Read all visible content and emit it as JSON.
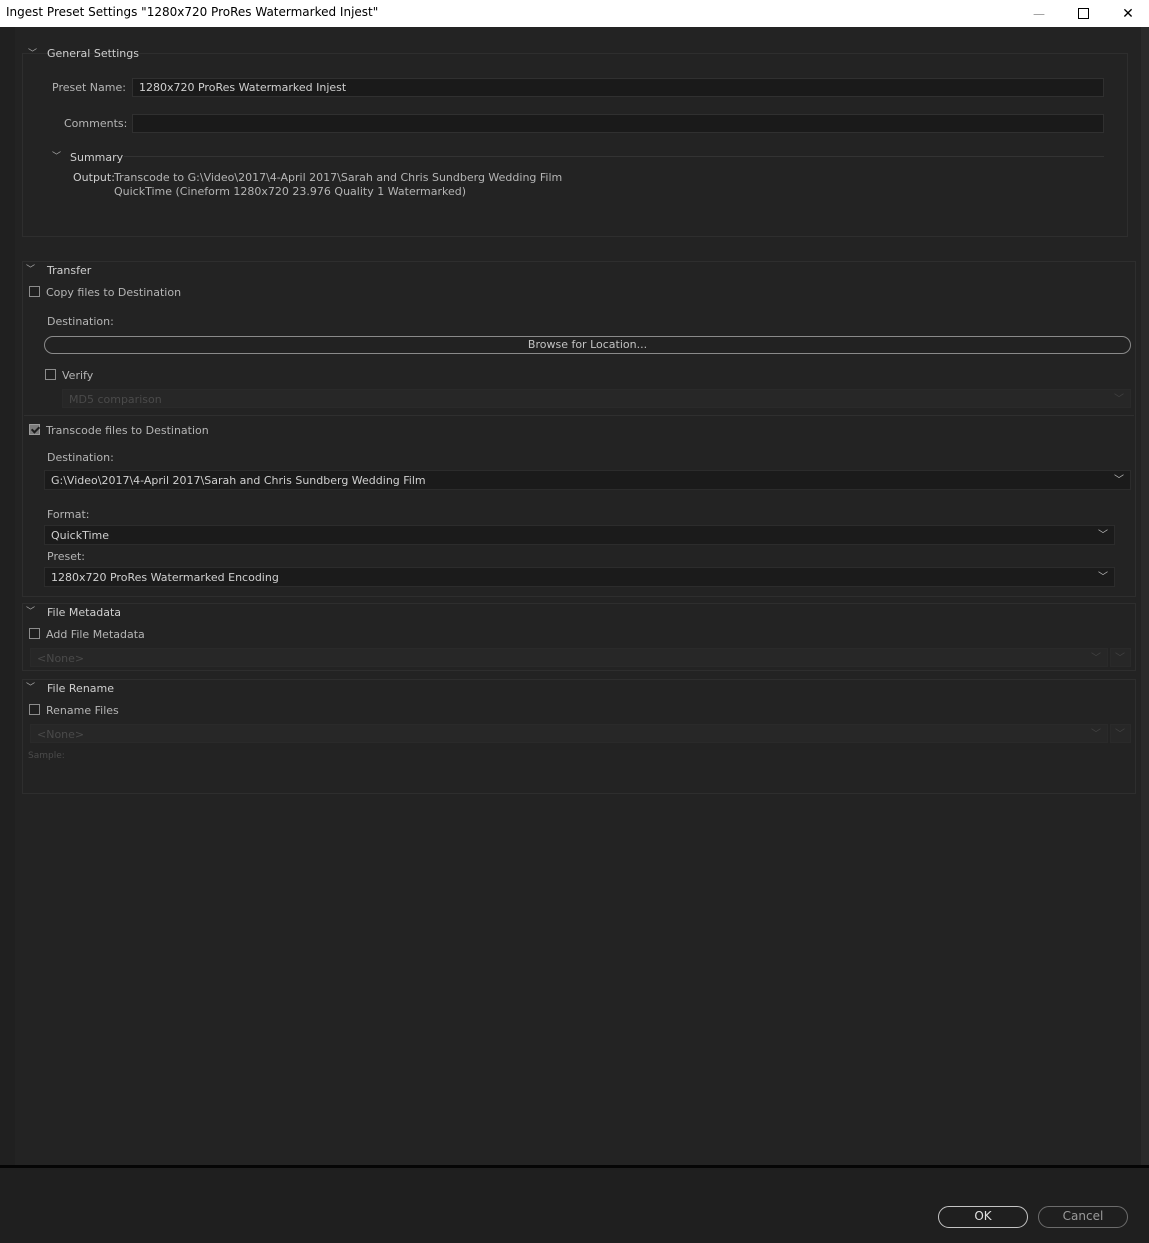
{
  "window": {
    "title": "Ingest Preset Settings \"1280x720 ProRes Watermarked Injest\"",
    "minimize_glyph": "—",
    "maximize_glyph": "☐",
    "close_glyph": "✕"
  },
  "general": {
    "heading": "General Settings",
    "preset_name_label": "Preset Name:",
    "preset_name_value": "1280x720 ProRes Watermarked Injest",
    "comments_label": "Comments:",
    "comments_value": "",
    "summary_heading": "Summary",
    "output_label": "Output:",
    "output_line1": "Transcode to G:\\Video\\2017\\4-April 2017\\Sarah and Chris Sundberg Wedding Film",
    "output_line2": "QuickTime (Cineform 1280x720 23.976 Quality 1 Watermarked)"
  },
  "transfer": {
    "heading": "Transfer",
    "copy_label": "Copy files to Destination",
    "copy_checked": false,
    "copy_destination_label": "Destination:",
    "browse_label": "Browse for Location...",
    "verify_label": "Verify",
    "verify_checked": false,
    "verify_method": "MD5 comparison",
    "transcode_label": "Transcode files to Destination",
    "transcode_checked": true,
    "transcode_destination_label": "Destination:",
    "transcode_destination_value": "G:\\Video\\2017\\4-April 2017\\Sarah and Chris Sundberg Wedding Film",
    "format_label": "Format:",
    "format_value": "QuickTime",
    "preset_label": "Preset:",
    "preset_value": "1280x720 ProRes Watermarked Encoding"
  },
  "metadata": {
    "heading": "File Metadata",
    "add_label": "Add File Metadata",
    "add_checked": false,
    "template_value": "<None>"
  },
  "rename": {
    "heading": "File Rename",
    "rename_label": "Rename Files",
    "rename_checked": false,
    "template_value": "<None>",
    "sample_label": "Sample:"
  },
  "footer": {
    "ok_label": "OK",
    "cancel_label": "Cancel"
  },
  "icons": {
    "twirl": "chevron-down-icon",
    "dropdown": "chevron-down-icon"
  }
}
